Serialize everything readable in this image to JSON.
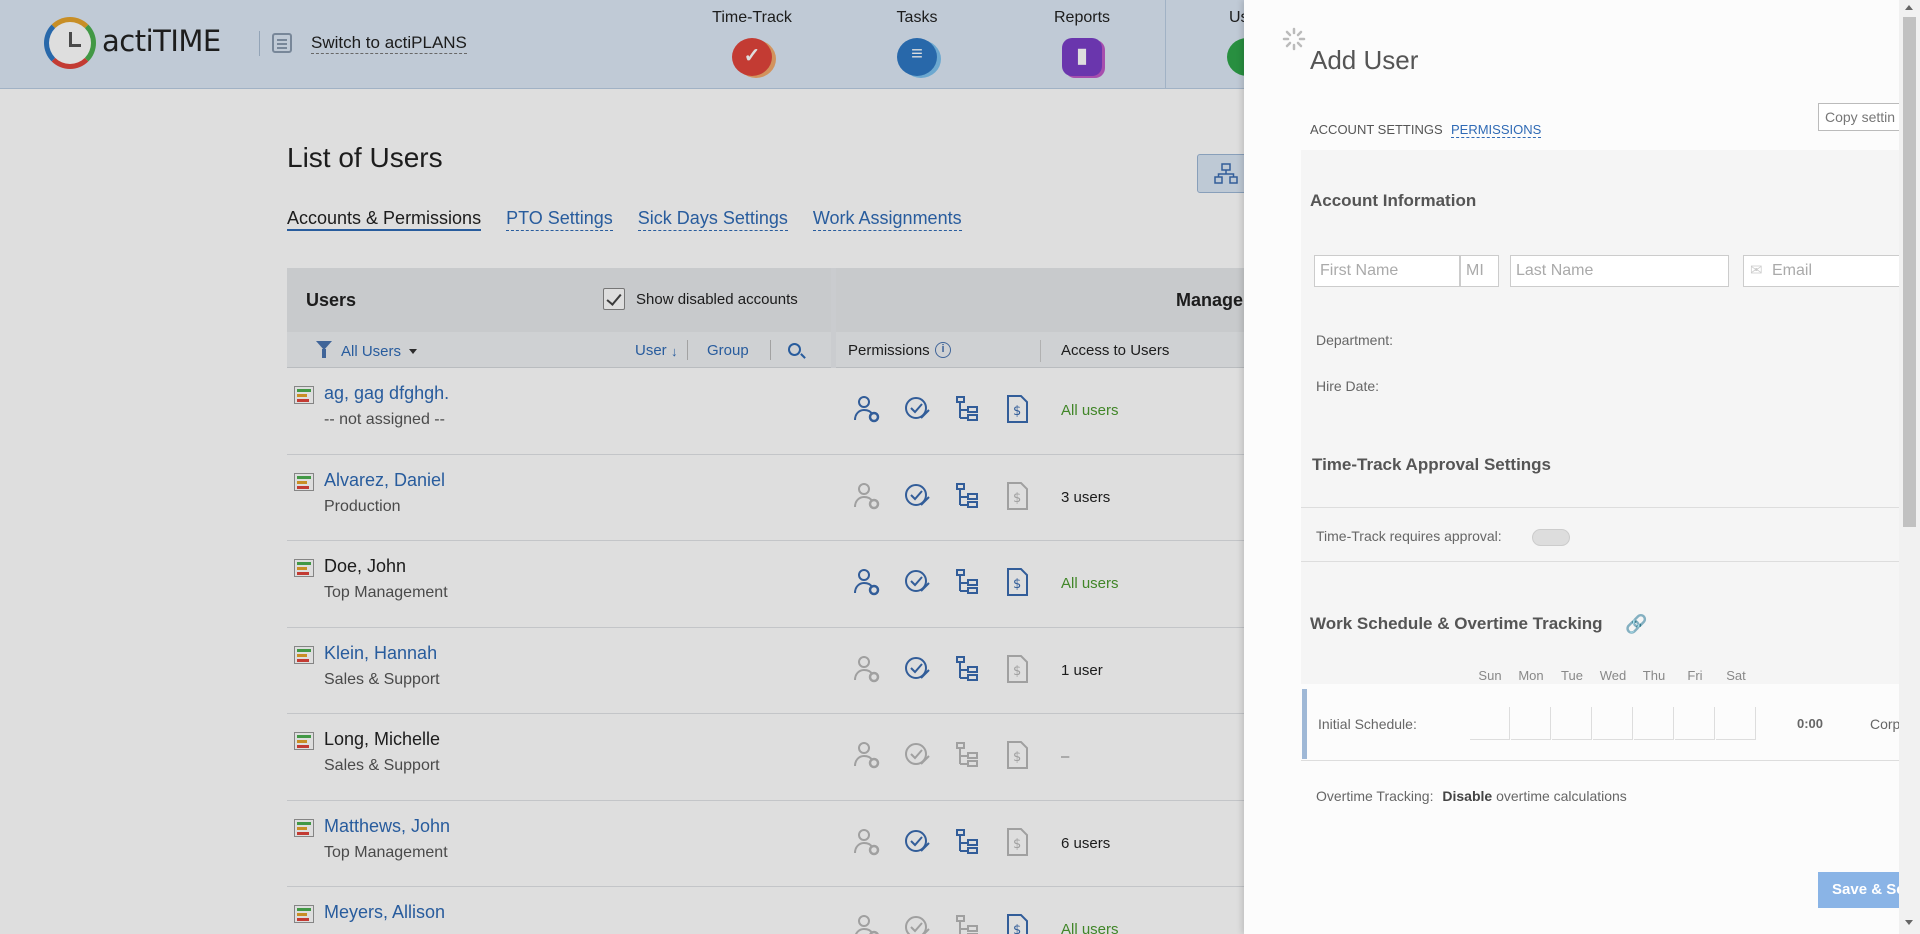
{
  "brand": {
    "name": "actiTIME"
  },
  "header": {
    "switch_label": "Switch to actiPLANS",
    "nav": [
      {
        "label": "Time-Track",
        "color": "#e0443b",
        "glyph": "✓"
      },
      {
        "label": "Tasks",
        "color": "#2f78c4",
        "glyph": "≡"
      },
      {
        "label": "Reports",
        "color": "#7a3ec7",
        "glyph": "▮"
      },
      {
        "label": "Us",
        "color": "#2fa54a",
        "glyph": ""
      }
    ]
  },
  "page": {
    "title": "List of Users",
    "tabs": [
      "Accounts & Permissions",
      "PTO Settings",
      "Sick Days Settings",
      "Work Assignments"
    ]
  },
  "table": {
    "users_title": "Users",
    "show_disabled_label": "Show disabled accounts",
    "show_disabled_checked": true,
    "filter_label": "All Users",
    "sort_user": "User",
    "sort_arrow": "↓",
    "sort_group": "Group",
    "management_title": "Managem",
    "permissions_label": "Permissions",
    "access_label": "Access to Users",
    "rows": [
      {
        "name": "ag, gag dfghgh.",
        "dept": "-- not assigned --",
        "link": true,
        "perms": [
          true,
          true,
          true,
          true
        ],
        "access": "All users",
        "access_style": "green"
      },
      {
        "name": "Alvarez, Daniel",
        "dept": "Production",
        "link": true,
        "perms": [
          false,
          true,
          true,
          false
        ],
        "access": "3 users",
        "access_style": "normal"
      },
      {
        "name": "Doe, John",
        "dept": "Top Management",
        "link": false,
        "perms": [
          true,
          true,
          true,
          true
        ],
        "access": "All users",
        "access_style": "green"
      },
      {
        "name": "Klein, Hannah",
        "dept": "Sales & Support",
        "link": true,
        "perms": [
          false,
          true,
          true,
          false
        ],
        "access": "1 user",
        "access_style": "normal"
      },
      {
        "name": "Long, Michelle",
        "dept": "Sales & Support",
        "link": false,
        "perms": [
          false,
          false,
          false,
          false
        ],
        "access": "–",
        "access_style": "dash"
      },
      {
        "name": "Matthews, John",
        "dept": "Top Management",
        "link": true,
        "perms": [
          false,
          true,
          true,
          false
        ],
        "access": "6 users",
        "access_style": "normal"
      },
      {
        "name": "Meyers, Allison",
        "dept": "",
        "link": true,
        "perms": [
          false,
          false,
          false,
          true
        ],
        "access": "All users",
        "access_style": "green"
      }
    ]
  },
  "panel": {
    "title": "Add User",
    "tab_account": "ACCOUNT SETTINGS",
    "tab_permissions": "PERMISSIONS",
    "copy_settings": "Copy settin",
    "account_section": "Account Information",
    "first_name_placeholder": "First Name",
    "mi_placeholder": "MI",
    "last_name_placeholder": "Last Name",
    "email_placeholder": "Email",
    "department_label": "Department:",
    "hire_date_label": "Hire Date:",
    "approval_section": "Time-Track Approval Settings",
    "approval_label": "Time-Track requires approval:",
    "schedule_section": "Work Schedule & Overtime Tracking",
    "days": [
      "Sun",
      "Mon",
      "Tue",
      "Wed",
      "Thu",
      "Fri",
      "Sat"
    ],
    "initial_schedule_label": "Initial Schedule:",
    "schedule_total": "0:00",
    "schedule_corp": "Corp",
    "overtime_label": "Overtime Tracking:",
    "overtime_value_bold": "Disable",
    "overtime_value_rest": "overtime calculations",
    "save_button": "Save & Se"
  }
}
